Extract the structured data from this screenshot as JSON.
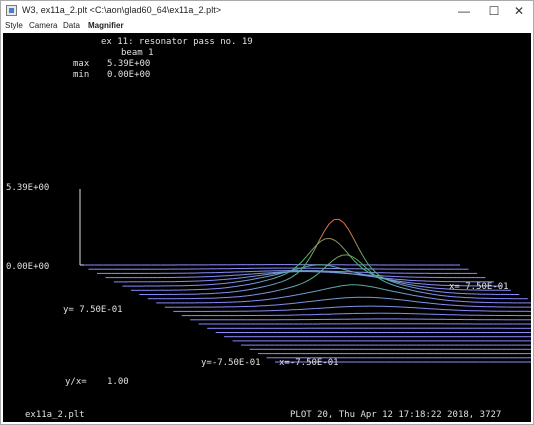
{
  "window": {
    "title": "W3, ex11a_2.plt <C:\\aon\\glad60_64\\ex11a_2.plt>",
    "controls": {
      "minimize": "—",
      "maximize": "☐",
      "close": "✕"
    }
  },
  "menu": {
    "items": [
      "Style",
      "Camera",
      "Data",
      "Magnifier"
    ]
  },
  "plot": {
    "title": "ex 11: resonator pass no. 19",
    "beam_label": "beam  1",
    "max_label": "max",
    "max_value": "5.39E+00",
    "min_label": "min",
    "min_value": "0.00E+00",
    "z_top_label": "5.39E+00",
    "z_bottom_label": "0.00E+00",
    "x_pos_label": "x= 7.50E-01",
    "y_pos_label": "y= 7.50E-01",
    "y_neg_label": "y=-7.50E-01",
    "x_neg_label": "x=-7.50E-01",
    "ratio_label": "y/x=",
    "ratio_value": "1.00",
    "filename": "ex11a_2.plt",
    "footer": "PLOT 20, Thu Apr 12 17:18:22 2018, 3727",
    "line_count": 24,
    "peak_value": 5.39,
    "colors": {
      "background": "#000000",
      "text": "#e0e0e0",
      "low": "#8c8cff",
      "mid": "#40c070",
      "high": "#ff6040"
    }
  }
}
